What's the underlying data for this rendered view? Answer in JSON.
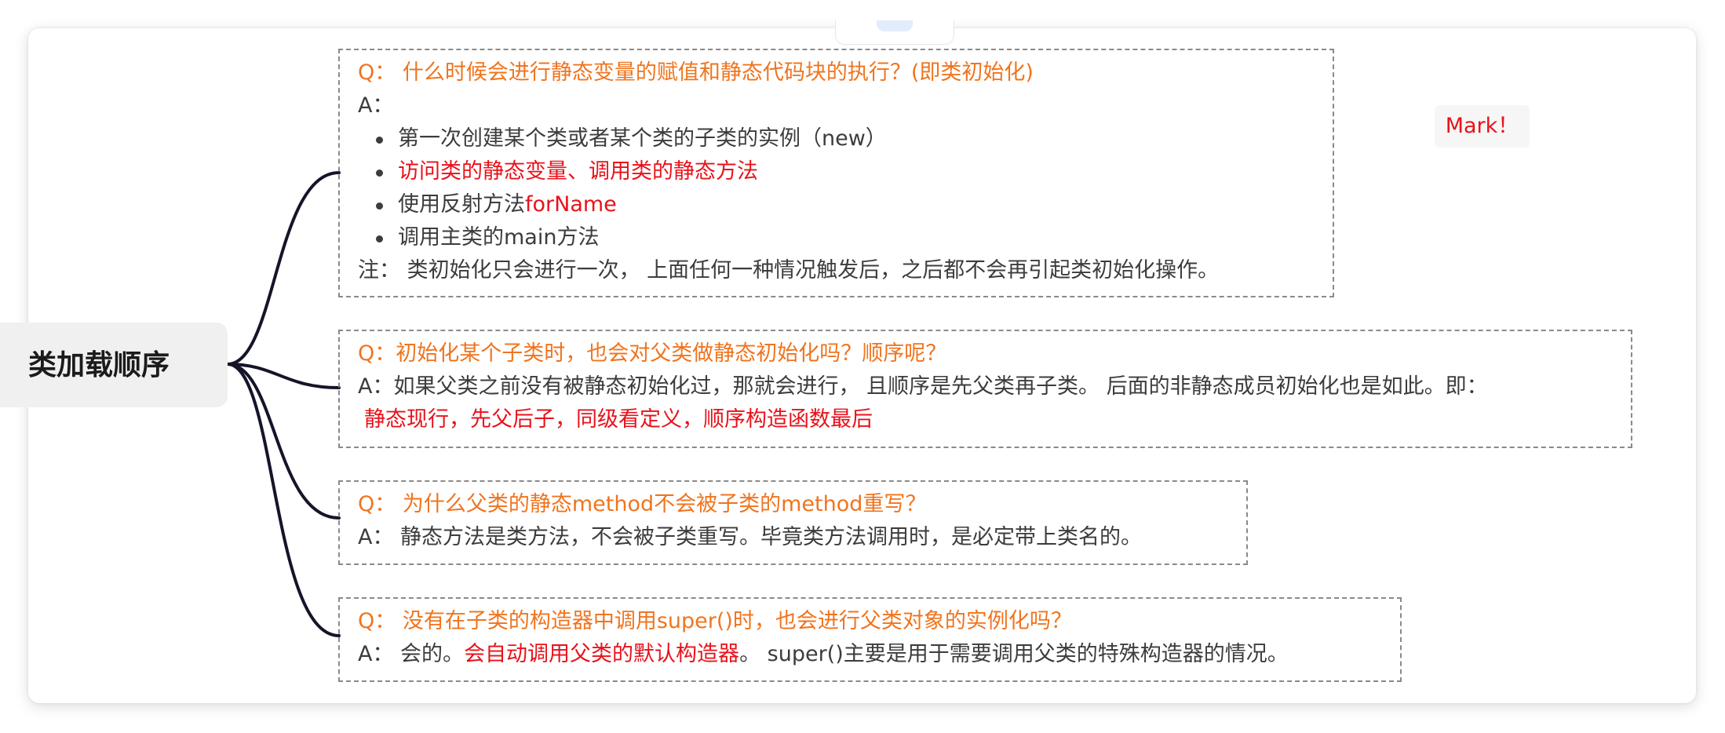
{
  "root": {
    "label": "类加载顺序"
  },
  "sticker": {
    "label": "Mark！"
  },
  "topics": [
    {
      "question": "Q：  什么时候会进行静态变量的赋值和静态代码块的执行？(即类初始化)",
      "answer_prefix": "A：",
      "bullets": [
        "第一次创建某个类或者某个类的子类的实例（new）",
        "访问类的静态变量、调用类的静态方法",
        "使用反射方法",
        "调用主类的main方法"
      ],
      "bullet3_highlight": "forName",
      "note": "注：  类初始化只会进行一次，  上面任何一种情况触发后，之后都不会再引起类初始化操作。"
    },
    {
      "question": "Q：初始化某个子类时，也会对父类做静态初始化吗？顺序呢？",
      "answer": "A：如果父类之前没有被静态初始化过，那就会进行，  且顺序是先父类再子类。  后面的非静态成员初始化也是如此。即：",
      "answer_highlight": "静态现行，先父后子，同级看定义，顺序构造函数最后"
    },
    {
      "question": "Q：  为什么父类的静态method不会被子类的method重写？",
      "answer": "A：  静态方法是类方法，不会被子类重写。毕竟类方法调用时，是必定带上类名的。"
    },
    {
      "question": "Q：  没有在子类的构造器中调用super()时，也会进行父类对象的实例化吗？",
      "answer_prefix": "A：  会的。",
      "answer_highlight": "会自动调用父类的默认构造器",
      "answer_suffix": "。  super()主要是用于需要调用父类的特殊构造器的情况。"
    }
  ],
  "colors": {
    "question": "#f0741e",
    "highlight": "#e8121b",
    "text": "#3c3c3c",
    "connector": "#15152a"
  }
}
